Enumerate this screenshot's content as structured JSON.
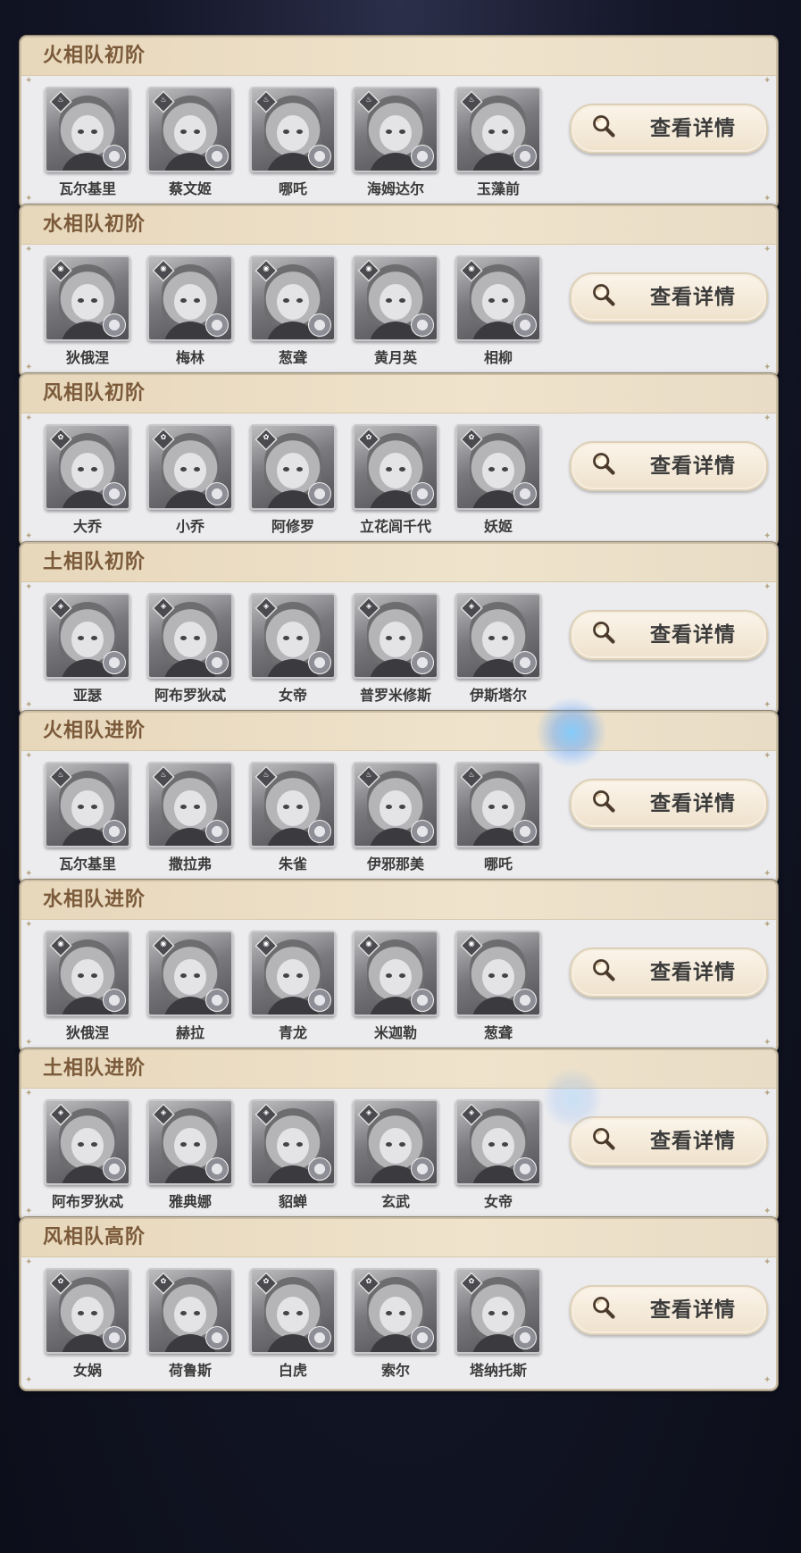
{
  "button_label": "查看详情",
  "teams": [
    {
      "title": "火相队初阶",
      "element_icon": "fire-icon",
      "heroes": [
        "瓦尔基里",
        "蔡文姬",
        "哪吒",
        "海姆达尔",
        "玉藻前"
      ]
    },
    {
      "title": "水相队初阶",
      "element_icon": "water-icon",
      "heroes": [
        "狄俄涅",
        "梅林",
        "葱聋",
        "黄月英",
        "相柳"
      ]
    },
    {
      "title": "风相队初阶",
      "element_icon": "wind-icon",
      "heroes": [
        "大乔",
        "小乔",
        "阿修罗",
        "立花闾千代",
        "妖姬"
      ]
    },
    {
      "title": "土相队初阶",
      "element_icon": "earth-icon",
      "heroes": [
        "亚瑟",
        "阿布罗狄忒",
        "女帝",
        "普罗米修斯",
        "伊斯塔尔"
      ]
    },
    {
      "title": "火相队进阶",
      "element_icon": "fire-icon",
      "heroes": [
        "瓦尔基里",
        "撒拉弗",
        "朱雀",
        "伊邪那美",
        "哪吒"
      ]
    },
    {
      "title": "水相队进阶",
      "element_icon": "water-icon",
      "heroes": [
        "狄俄涅",
        "赫拉",
        "青龙",
        "米迦勒",
        "葱聋"
      ]
    },
    {
      "title": "土相队进阶",
      "element_icon": "earth-icon",
      "heroes": [
        "阿布罗狄忒",
        "雅典娜",
        "貂蝉",
        "玄武",
        "女帝"
      ]
    },
    {
      "title": "风相队高阶",
      "element_icon": "wind-icon",
      "heroes": [
        "女娲",
        "荷鲁斯",
        "白虎",
        "索尔",
        "塔纳托斯"
      ]
    }
  ],
  "colors": {
    "header_text": "#7b5a3a",
    "panel_bg": "#ececee",
    "button_bg": "#f4ead9"
  }
}
